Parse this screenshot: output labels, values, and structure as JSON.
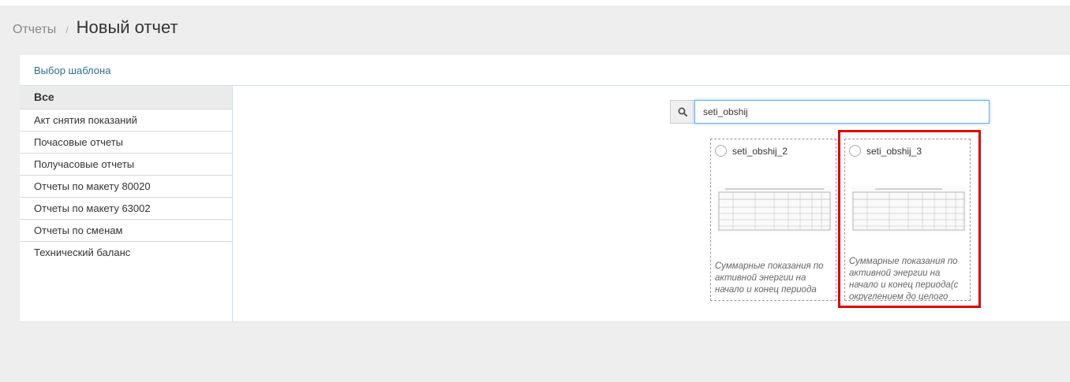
{
  "breadcrumb": {
    "parent": "Отчеты",
    "separator": "/",
    "current": "Новый отчет"
  },
  "panel": {
    "title": "Выбор шаблона"
  },
  "categories": [
    "Все",
    "Акт снятия показаний",
    "Почасовые отчеты",
    "Получасовые отчеты",
    "Отчеты по макету 80020",
    "Отчеты по макету 63002",
    "Отчеты по сменам",
    "Технический баланс"
  ],
  "search": {
    "value": "seti_obshij",
    "icon": "search-icon"
  },
  "templates": [
    {
      "name": "seti_obshij_2",
      "description": "Суммарные показания по активной энергии на начало и конец периода"
    },
    {
      "name": "seti_obshij_3",
      "description": "Суммарные показания по активной энергии на начало и конец периода(с округлением до целого"
    }
  ],
  "colors": {
    "highlight": "#e00000",
    "link": "#2f6f93",
    "focus": "#66afe9"
  }
}
